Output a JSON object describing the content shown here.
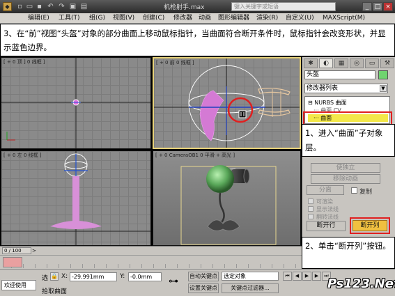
{
  "titlebar": {
    "app_icon": "3ds-max-icon",
    "title": "机枪射手.max",
    "search_placeholder": "键入关键字或短语"
  },
  "menubar": {
    "items": [
      "编辑(E)",
      "工具(T)",
      "组(G)",
      "视图(V)",
      "创建(C)",
      "修改器",
      "动画",
      "图形编辑器",
      "渲染(R)",
      "自定义(U)",
      "MAXScript(M)"
    ]
  },
  "instruction": {
    "text": "3、在“前”视图“头盔”对象的部分曲面上移动鼠标指针，当曲面符合断开条件时，鼠标指针会改变形状，并显示蓝色边界。"
  },
  "viewports": {
    "top_label": "[ + 0 顶 ] 0 线框 ]",
    "front_label": "[ + 0 前 0 线框 ]",
    "left_label": "[ + 0 左 0 线框 ]",
    "persp_label": "[ + 0 CameraOB1 0 平滑 + 高光 ]"
  },
  "cmdpanel": {
    "tabs": [
      "✱",
      "◐",
      "▦",
      "◎",
      "▭",
      "⚒"
    ],
    "object_name": "头盔",
    "object_color": "#6fd46f",
    "modifier_list": "修改器列表",
    "stack": {
      "root": "NURBS 曲面",
      "child1": "曲面 CV",
      "child2": "曲面"
    },
    "make_independent": "使独立",
    "remove_animation": "移除动画",
    "detach": "分离",
    "copy": "复制",
    "chk1": "可渲染",
    "chk2": "显示法线",
    "chk3": "翻转法线",
    "break_row": "断开行",
    "break_col": "断开列"
  },
  "callouts": {
    "c1": "1、进入“曲面”子对象层。",
    "c2": "2、单击“断开列”按钮。"
  },
  "timebar": {
    "frame_counter": "0 / 100"
  },
  "statusbar": {
    "selection_label": "选",
    "x_label": "X:",
    "x_value": "-29.991mm",
    "y_label": "Y:",
    "y_value": "-0.0mm",
    "auto_key": "自动关键点",
    "selected_object": "选定对象",
    "set_key": "设置关键点",
    "key_filters": "关键点过滤器...",
    "welcome": "欢迎使用",
    "prompt": "拾取曲面",
    "watermark": "Ps123.Net"
  },
  "colors": {
    "selection_highlight": "#f3e84a",
    "callout_border": "#e02020",
    "front_active_border": "#e8d37a"
  }
}
